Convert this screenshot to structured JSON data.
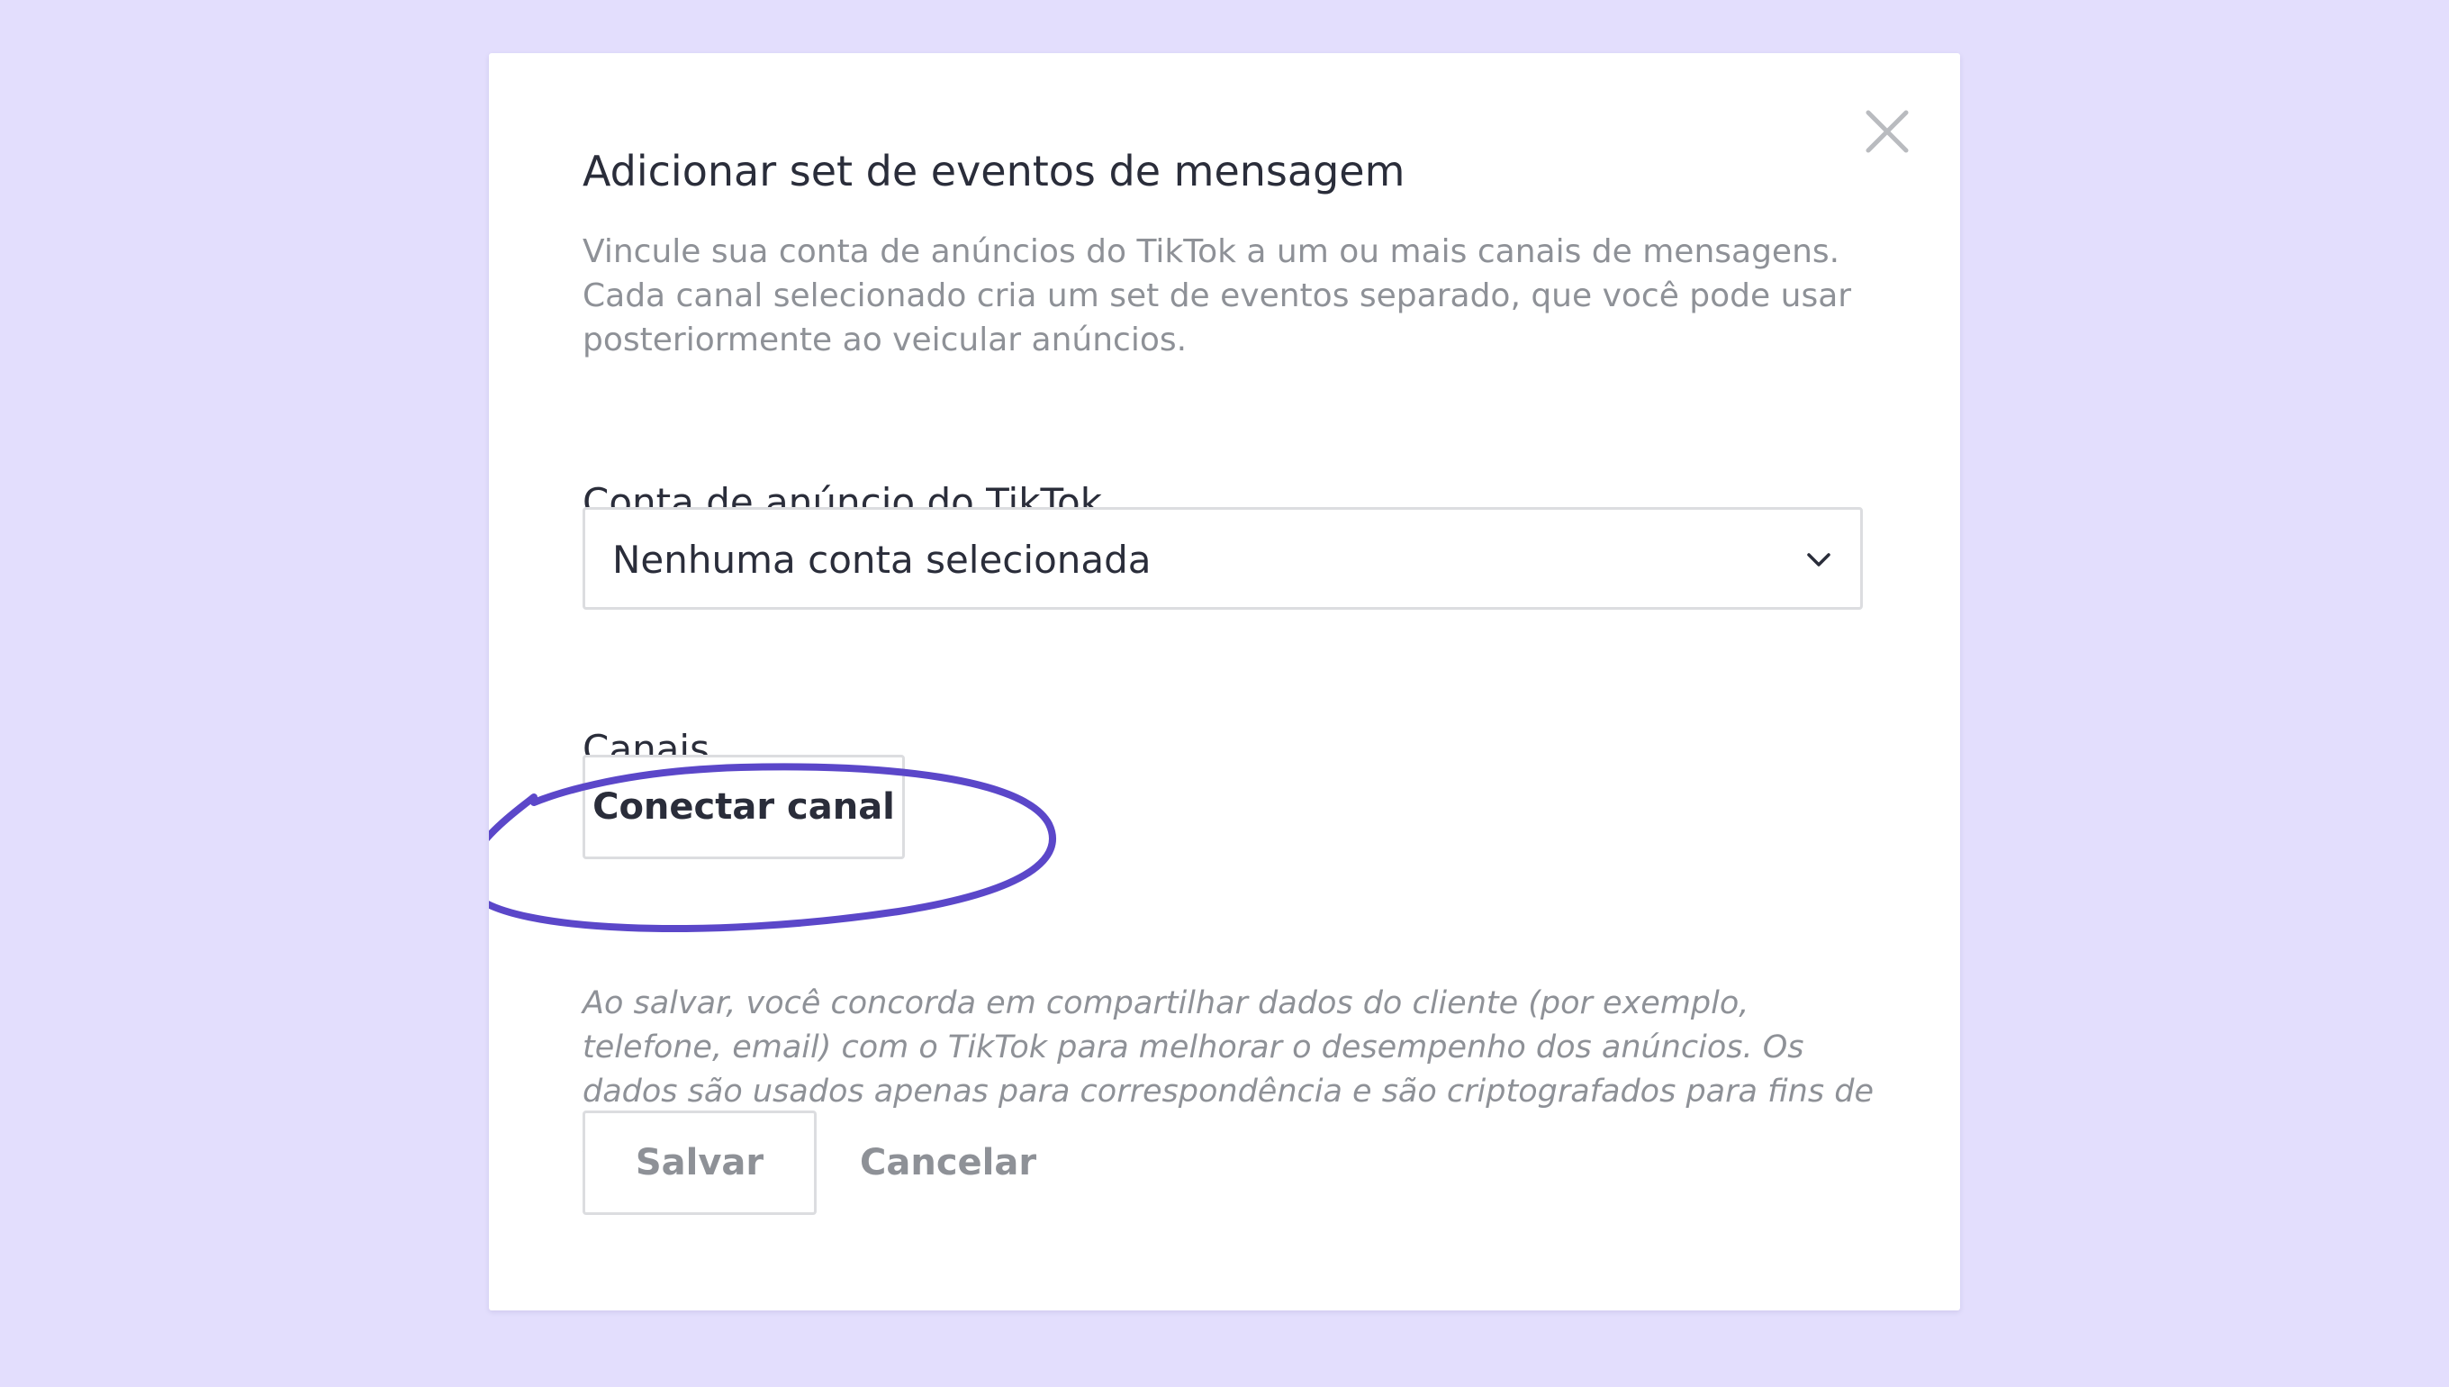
{
  "dialog": {
    "title": "Adicionar set de eventos de mensagem",
    "description": "Vincule sua conta de anúncios do TikTok a um ou mais canais de mensagens. Cada canal selecionado cria um set de eventos separado, que você pode usar posteriormente ao veicular anúncios.",
    "close_icon": "close-icon",
    "ad_account": {
      "label": "Conta de anúncio do TikTok",
      "selected_value": "Nenhuma conta selecionada",
      "icon": "chevron-down-icon"
    },
    "channels": {
      "label": "Canais",
      "connect_button_label": "Conectar canal",
      "highlight_color": "#5b47c9"
    },
    "disclaimer": "Ao salvar, você concorda em compartilhar dados do cliente (por exemplo, telefone, email) com o TikTok para melhorar o desempenho dos anúncios. Os dados são usados apenas para correspondência e são criptografados para fins de privacidade.",
    "actions": {
      "save_label": "Salvar",
      "cancel_label": "Cancelar"
    }
  },
  "colors": {
    "page_background": "#e3defd",
    "dialog_background": "#ffffff",
    "primary_text": "#2a2d3a",
    "secondary_text": "#8e9197",
    "border": "#dcdde0",
    "accent": "#5b47c9"
  }
}
